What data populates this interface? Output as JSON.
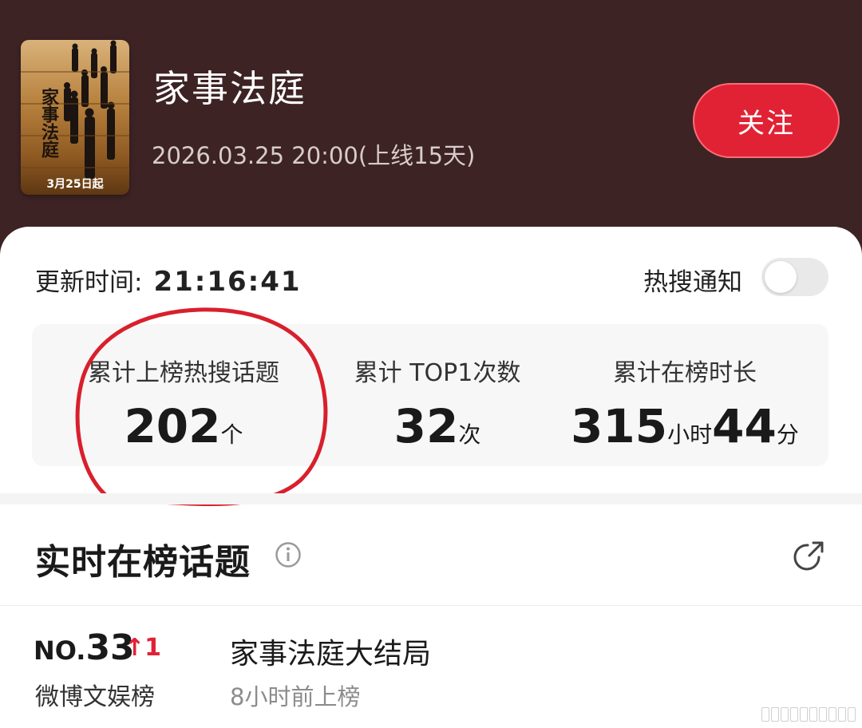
{
  "header": {
    "poster": {
      "title": "家事法庭",
      "date": "3月25日起"
    },
    "title": "家事法庭",
    "premiere": "2026.03.25 20:00(上线15天)",
    "follow_label": "关注"
  },
  "update": {
    "label": "更新时间:",
    "time": "21:16:41"
  },
  "notify": {
    "label": "热搜通知",
    "enabled": false
  },
  "stats": [
    {
      "label": "累计上榜热搜话题",
      "value": "202",
      "unit": "个"
    },
    {
      "label": "累计 TOP1次数",
      "value": "32",
      "unit": "次"
    },
    {
      "label": "累计在榜时长",
      "hours": "315",
      "hours_unit": "小时",
      "minutes": "44",
      "minutes_unit": "分"
    }
  ],
  "section": {
    "title": "实时在榜话题"
  },
  "topics": [
    {
      "rank_prefix": "NO.",
      "rank": "33",
      "change": "↑1",
      "board": "微博文娱榜",
      "name": "家事法庭大结局",
      "time": "8小时前上榜"
    }
  ],
  "colors": {
    "header_bg": "#3d2324",
    "accent": "#e12235",
    "annotation": "#d8202c"
  },
  "icons": [
    "info-icon",
    "share-icon"
  ]
}
